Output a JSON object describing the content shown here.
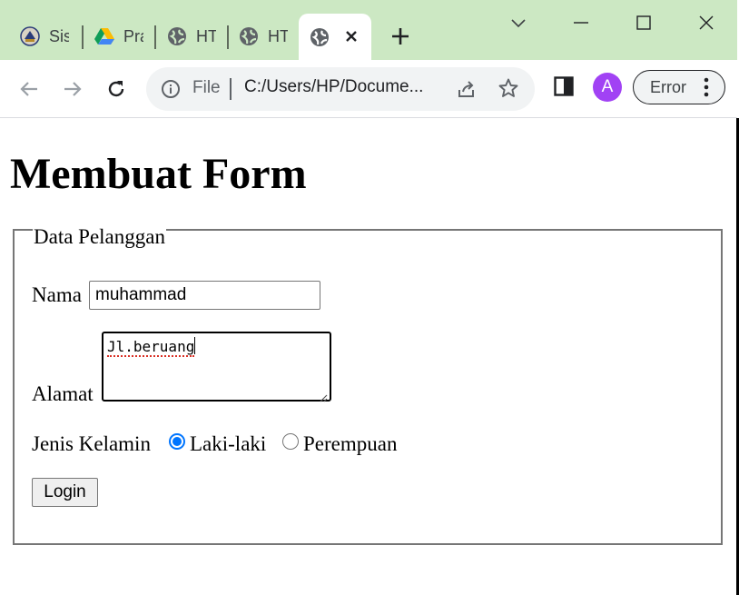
{
  "browser": {
    "tabs": [
      {
        "title": "Sis",
        "icon": "seal-icon"
      },
      {
        "title": "Pra",
        "icon": "google-drive-icon"
      },
      {
        "title": "HT",
        "icon": "globe-icon"
      },
      {
        "title": "HT",
        "icon": "globe-icon"
      },
      {
        "title": "",
        "icon": "globe-icon",
        "active": true
      }
    ],
    "omnibox": {
      "scheme_label": "File",
      "url": "C:/Users/HP/Docume..."
    },
    "profile_initial": "A",
    "error_label": "Error"
  },
  "page": {
    "title": "Membuat Form",
    "legend": "Data Pelanggan",
    "nama": {
      "label": "Nama",
      "value": "muhammad"
    },
    "alamat": {
      "label": "Alamat",
      "value": "Jl.beruang"
    },
    "jenis_kelamin": {
      "label": "Jenis Kelamin",
      "options": [
        {
          "label": "Laki-laki",
          "checked": true
        },
        {
          "label": "Perempuan",
          "checked": false
        }
      ]
    },
    "submit_label": "Login"
  },
  "colors": {
    "tabstrip_bg": "#cce8c3",
    "radio_accent": "#0075ff",
    "avatar_bg": "#a142f4"
  }
}
